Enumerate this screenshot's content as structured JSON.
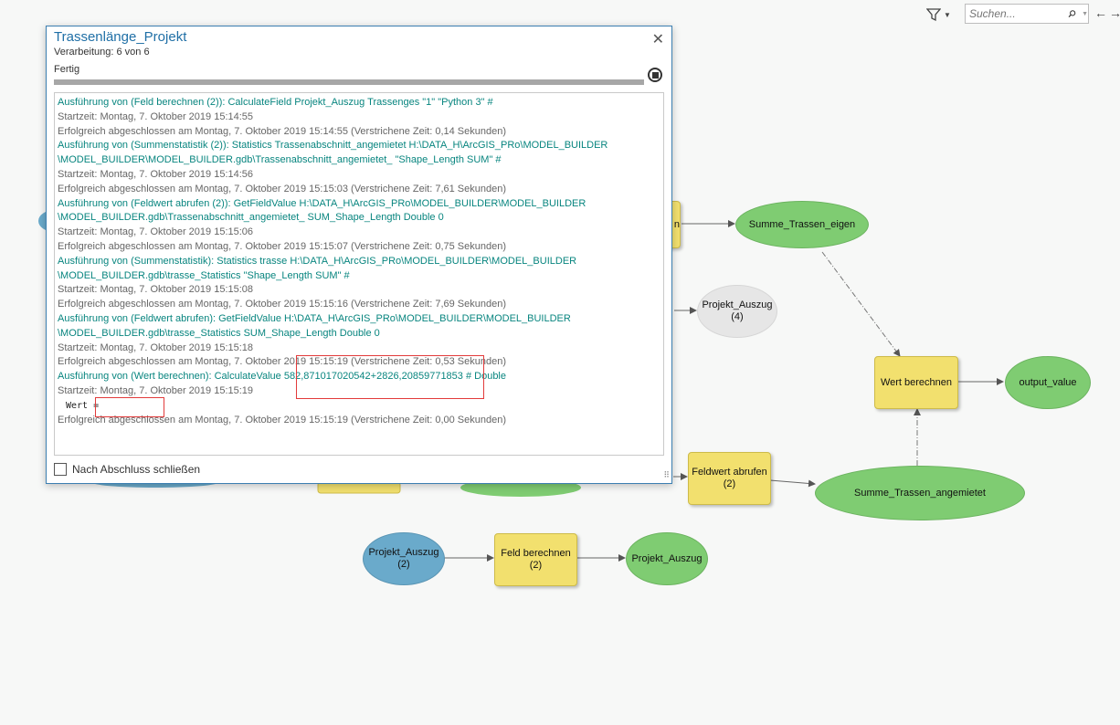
{
  "toolbar": {
    "filter_icon": "filter-icon",
    "search_placeholder": "Suchen...",
    "search_icon": "search-icon",
    "nav_back": "←",
    "nav_forward": "→"
  },
  "colors": {
    "output_node": "#7fcc72",
    "input_node": "#6aaacb",
    "tool_node": "#f2e06e",
    "dialog_title": "#1f6fa6",
    "log_command": "#08857f",
    "highlight": "#e23b3b"
  },
  "model": {
    "nodes": {
      "summe_trassen_eigen": "Summe_Trassen_eigen",
      "projekt_auszug_4": "Projekt_Auszug\n(4)",
      "wert_berechnen": "Wert berechnen",
      "output_value": "output_value",
      "feldwert_abrufen_2": "Feldwert abrufen\n(2)",
      "summe_trassen_angemietet": "Summe_Trassen_angemietet",
      "projekt_auszug_2_input": "Projekt_Auszug\n(2)",
      "feld_berechnen_2": "Feld berechnen\n(2)",
      "projekt_auszug_output": "Projekt_Auszug",
      "partial_tool_label": "n"
    }
  },
  "dialog": {
    "title": "Trassenlänge_Projekt",
    "progress_text": "Verarbeitung: 6 von 6",
    "status": "Fertig",
    "progress": 1.0,
    "close_label": "✕",
    "log": [
      {
        "type": "cmd",
        "text": "Ausführung von (Feld berechnen (2)): CalculateField Projekt_Auszug Trassenges \"1\" \"Python 3\" #"
      },
      {
        "type": "info",
        "text": "Startzeit: Montag, 7. Oktober 2019 15:14:55"
      },
      {
        "type": "info",
        "text": "Erfolgreich abgeschlossen am Montag, 7. Oktober 2019 15:14:55 (Verstrichene Zeit: 0,14 Sekunden)"
      },
      {
        "type": "cmd",
        "text": "Ausführung von (Summenstatistik (2)): Statistics Trassenabschnitt_angemietet H:\\DATA_H\\ArcGIS_PRo\\MODEL_BUILDER"
      },
      {
        "type": "cmd",
        "text": "\\MODEL_BUILDER\\MODEL_BUILDER.gdb\\Trassenabschnitt_angemietet_ \"Shape_Length SUM\" #"
      },
      {
        "type": "info",
        "text": "Startzeit: Montag, 7. Oktober 2019 15:14:56"
      },
      {
        "type": "info",
        "text": "Erfolgreich abgeschlossen am Montag, 7. Oktober 2019 15:15:03 (Verstrichene Zeit: 7,61 Sekunden)"
      },
      {
        "type": "cmd",
        "text": "Ausführung von (Feldwert abrufen (2)): GetFieldValue H:\\DATA_H\\ArcGIS_PRo\\MODEL_BUILDER\\MODEL_BUILDER"
      },
      {
        "type": "cmd",
        "text": "\\MODEL_BUILDER.gdb\\Trassenabschnitt_angemietet_ SUM_Shape_Length Double 0"
      },
      {
        "type": "info",
        "text": "Startzeit: Montag, 7. Oktober 2019 15:15:06"
      },
      {
        "type": "info",
        "text": "Erfolgreich abgeschlossen am Montag, 7. Oktober 2019 15:15:07 (Verstrichene Zeit: 0,75 Sekunden)"
      },
      {
        "type": "cmd",
        "text": "Ausführung von (Summenstatistik): Statistics trasse H:\\DATA_H\\ArcGIS_PRo\\MODEL_BUILDER\\MODEL_BUILDER"
      },
      {
        "type": "cmd",
        "text": "\\MODEL_BUILDER.gdb\\trasse_Statistics \"Shape_Length SUM\" #"
      },
      {
        "type": "info",
        "text": "Startzeit: Montag, 7. Oktober 2019 15:15:08"
      },
      {
        "type": "info",
        "text": "Erfolgreich abgeschlossen am Montag, 7. Oktober 2019 15:15:16 (Verstrichene Zeit: 7,69 Sekunden)"
      },
      {
        "type": "cmd",
        "text": "Ausführung von (Feldwert abrufen): GetFieldValue H:\\DATA_H\\ArcGIS_PRo\\MODEL_BUILDER\\MODEL_BUILDER"
      },
      {
        "type": "cmd",
        "text": "\\MODEL_BUILDER.gdb\\trasse_Statistics SUM_Shape_Length Double 0"
      },
      {
        "type": "info",
        "text": "Startzeit: Montag, 7. Oktober 2019 15:15:18"
      },
      {
        "type": "info",
        "text": "Erfolgreich abgeschlossen am Montag, 7. Oktober 2019 15:15:19 (Verstrichene Zeit: 0,53 Sekunden)"
      },
      {
        "type": "cmd",
        "text": "Ausführung von (Wert berechnen): CalculateValue 582,871017020542+2826,20859771853 # Double"
      },
      {
        "type": "info",
        "text": "Startzeit: Montag, 7. Oktober 2019 15:15:19"
      },
      {
        "type": "mono",
        "text": "Wert ="
      },
      {
        "type": "info",
        "text": "Erfolgreich abgeschlossen am Montag, 7. Oktober 2019 15:15:19 (Verstrichene Zeit: 0,00 Sekunden)"
      }
    ],
    "close_on_finish_label": "Nach Abschluss schließen",
    "close_on_finish_checked": false
  }
}
